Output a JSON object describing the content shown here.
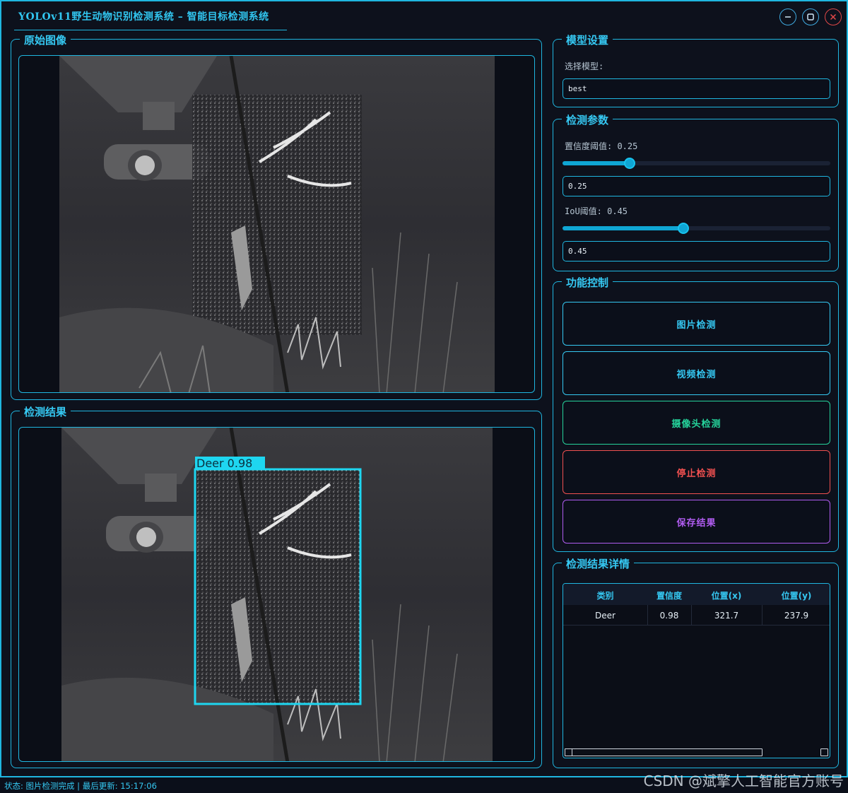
{
  "window": {
    "title": "YOLOv11野生动物识别检测系统 – 智能目标检测系统"
  },
  "panels": {
    "original_title": "原始图像",
    "result_title": "检测结果"
  },
  "detection_overlay": {
    "label": "Deer 0.98"
  },
  "model": {
    "group_title": "模型设置",
    "select_label": "选择模型:",
    "selected_model": "best"
  },
  "params": {
    "group_title": "检测参数",
    "conf_label": "置信度阈值: 0.25",
    "conf_value": "0.25",
    "conf_level": 0.25,
    "iou_label": "IoU阈值: 0.45",
    "iou_value": "0.45",
    "iou_level": 0.45
  },
  "controls": {
    "group_title": "功能控制",
    "buttons": [
      {
        "label": "图片检测",
        "color": "#35c8f2"
      },
      {
        "label": "视频检测",
        "color": "#35c8f2"
      },
      {
        "label": "摄像头检测",
        "color": "#25d39b"
      },
      {
        "label": "停止检测",
        "color": "#f05050"
      },
      {
        "label": "保存结果",
        "color": "#b05cf0"
      }
    ]
  },
  "results": {
    "group_title": "检测结果详情",
    "columns": [
      "类别",
      "置信度",
      "位置(x)",
      "位置(y)"
    ],
    "rows": [
      [
        "Deer",
        "0.98",
        "321.7",
        "237.9"
      ]
    ]
  },
  "status": {
    "text": "状态: 图片检测完成 | 最后更新: 15:17:06"
  },
  "watermark": "CSDN @斌擎人工智能官方账号",
  "colors": {
    "accent": "#1fb6e0",
    "background": "#0d111c",
    "close": "#e14848"
  }
}
